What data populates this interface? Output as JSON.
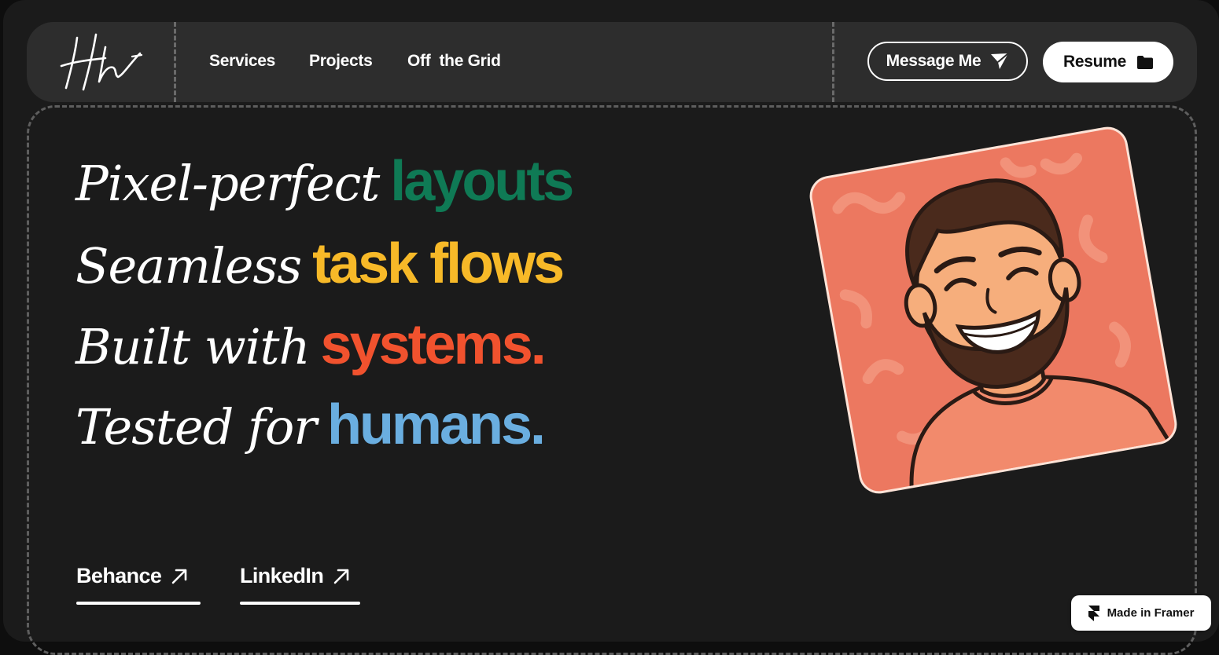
{
  "nav": {
    "logo_icon": "hh-signature-logo",
    "links": [
      "Services",
      "Projects",
      "Off  the Grid"
    ],
    "message_label": "Message Me",
    "message_icon": "send-icon",
    "resume_label": "Resume",
    "resume_icon": "folder-icon"
  },
  "hero": {
    "lines": [
      {
        "plain": "Pixel-perfect",
        "accent": "layouts",
        "color": "#0f7a55"
      },
      {
        "plain": "Seamless",
        "accent": "task flows",
        "color": "#f7b928"
      },
      {
        "plain": "Built with",
        "accent": "systems.",
        "color": "#f1522e"
      },
      {
        "plain": "Tested for",
        "accent": "humans.",
        "color": "#6aaee0"
      }
    ]
  },
  "avatar": {
    "icon": "smiling-man-illustration",
    "background_color": "#ec7860"
  },
  "social": {
    "behance": "Behance",
    "linkedin": "LinkedIn",
    "arrow_icon": "arrow-up-right-icon"
  },
  "badge": {
    "label": "Made in Framer",
    "icon": "framer-logo-icon"
  }
}
